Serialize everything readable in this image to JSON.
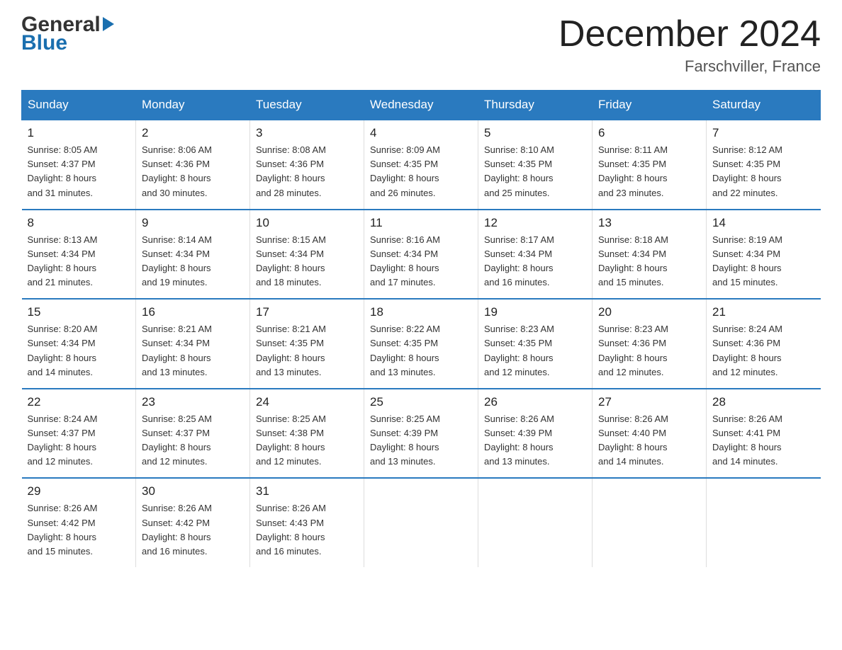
{
  "header": {
    "logo_general": "General",
    "logo_blue": "Blue",
    "title": "December 2024",
    "location": "Farschviller, France"
  },
  "days_of_week": [
    "Sunday",
    "Monday",
    "Tuesday",
    "Wednesday",
    "Thursday",
    "Friday",
    "Saturday"
  ],
  "weeks": [
    [
      {
        "num": "1",
        "sunrise": "8:05 AM",
        "sunset": "4:37 PM",
        "daylight": "8 hours and 31 minutes."
      },
      {
        "num": "2",
        "sunrise": "8:06 AM",
        "sunset": "4:36 PM",
        "daylight": "8 hours and 30 minutes."
      },
      {
        "num": "3",
        "sunrise": "8:08 AM",
        "sunset": "4:36 PM",
        "daylight": "8 hours and 28 minutes."
      },
      {
        "num": "4",
        "sunrise": "8:09 AM",
        "sunset": "4:35 PM",
        "daylight": "8 hours and 26 minutes."
      },
      {
        "num": "5",
        "sunrise": "8:10 AM",
        "sunset": "4:35 PM",
        "daylight": "8 hours and 25 minutes."
      },
      {
        "num": "6",
        "sunrise": "8:11 AM",
        "sunset": "4:35 PM",
        "daylight": "8 hours and 23 minutes."
      },
      {
        "num": "7",
        "sunrise": "8:12 AM",
        "sunset": "4:35 PM",
        "daylight": "8 hours and 22 minutes."
      }
    ],
    [
      {
        "num": "8",
        "sunrise": "8:13 AM",
        "sunset": "4:34 PM",
        "daylight": "8 hours and 21 minutes."
      },
      {
        "num": "9",
        "sunrise": "8:14 AM",
        "sunset": "4:34 PM",
        "daylight": "8 hours and 19 minutes."
      },
      {
        "num": "10",
        "sunrise": "8:15 AM",
        "sunset": "4:34 PM",
        "daylight": "8 hours and 18 minutes."
      },
      {
        "num": "11",
        "sunrise": "8:16 AM",
        "sunset": "4:34 PM",
        "daylight": "8 hours and 17 minutes."
      },
      {
        "num": "12",
        "sunrise": "8:17 AM",
        "sunset": "4:34 PM",
        "daylight": "8 hours and 16 minutes."
      },
      {
        "num": "13",
        "sunrise": "8:18 AM",
        "sunset": "4:34 PM",
        "daylight": "8 hours and 15 minutes."
      },
      {
        "num": "14",
        "sunrise": "8:19 AM",
        "sunset": "4:34 PM",
        "daylight": "8 hours and 15 minutes."
      }
    ],
    [
      {
        "num": "15",
        "sunrise": "8:20 AM",
        "sunset": "4:34 PM",
        "daylight": "8 hours and 14 minutes."
      },
      {
        "num": "16",
        "sunrise": "8:21 AM",
        "sunset": "4:34 PM",
        "daylight": "8 hours and 13 minutes."
      },
      {
        "num": "17",
        "sunrise": "8:21 AM",
        "sunset": "4:35 PM",
        "daylight": "8 hours and 13 minutes."
      },
      {
        "num": "18",
        "sunrise": "8:22 AM",
        "sunset": "4:35 PM",
        "daylight": "8 hours and 13 minutes."
      },
      {
        "num": "19",
        "sunrise": "8:23 AM",
        "sunset": "4:35 PM",
        "daylight": "8 hours and 12 minutes."
      },
      {
        "num": "20",
        "sunrise": "8:23 AM",
        "sunset": "4:36 PM",
        "daylight": "8 hours and 12 minutes."
      },
      {
        "num": "21",
        "sunrise": "8:24 AM",
        "sunset": "4:36 PM",
        "daylight": "8 hours and 12 minutes."
      }
    ],
    [
      {
        "num": "22",
        "sunrise": "8:24 AM",
        "sunset": "4:37 PM",
        "daylight": "8 hours and 12 minutes."
      },
      {
        "num": "23",
        "sunrise": "8:25 AM",
        "sunset": "4:37 PM",
        "daylight": "8 hours and 12 minutes."
      },
      {
        "num": "24",
        "sunrise": "8:25 AM",
        "sunset": "4:38 PM",
        "daylight": "8 hours and 12 minutes."
      },
      {
        "num": "25",
        "sunrise": "8:25 AM",
        "sunset": "4:39 PM",
        "daylight": "8 hours and 13 minutes."
      },
      {
        "num": "26",
        "sunrise": "8:26 AM",
        "sunset": "4:39 PM",
        "daylight": "8 hours and 13 minutes."
      },
      {
        "num": "27",
        "sunrise": "8:26 AM",
        "sunset": "4:40 PM",
        "daylight": "8 hours and 14 minutes."
      },
      {
        "num": "28",
        "sunrise": "8:26 AM",
        "sunset": "4:41 PM",
        "daylight": "8 hours and 14 minutes."
      }
    ],
    [
      {
        "num": "29",
        "sunrise": "8:26 AM",
        "sunset": "4:42 PM",
        "daylight": "8 hours and 15 minutes."
      },
      {
        "num": "30",
        "sunrise": "8:26 AM",
        "sunset": "4:42 PM",
        "daylight": "8 hours and 16 minutes."
      },
      {
        "num": "31",
        "sunrise": "8:26 AM",
        "sunset": "4:43 PM",
        "daylight": "8 hours and 16 minutes."
      },
      null,
      null,
      null,
      null
    ]
  ],
  "labels": {
    "sunrise": "Sunrise:",
    "sunset": "Sunset:",
    "daylight": "Daylight:"
  }
}
